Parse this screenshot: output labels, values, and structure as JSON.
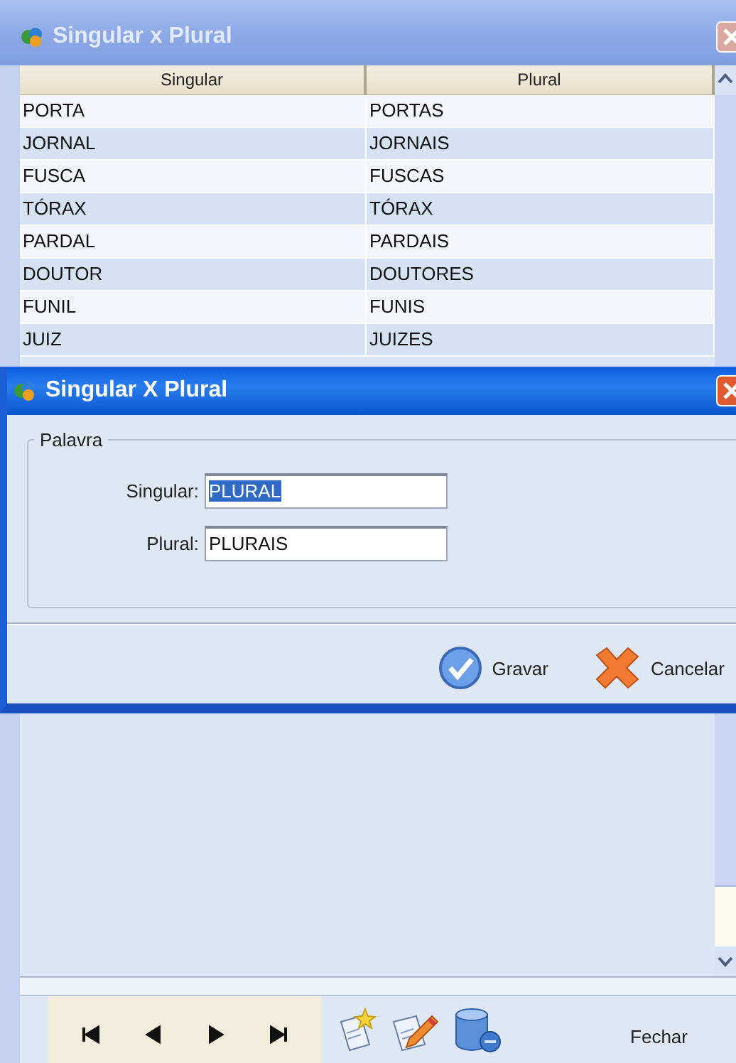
{
  "main_window": {
    "title": "Singular x Plural",
    "active": false
  },
  "table": {
    "columns": [
      "Singular",
      "Plural"
    ],
    "rows": [
      {
        "cells": [
          "PORTA",
          "PORTAS"
        ]
      },
      {
        "cells": [
          "JORNAL",
          "JORNAIS"
        ]
      },
      {
        "cells": [
          "FUSCA",
          "FUSCAS"
        ]
      },
      {
        "cells": [
          "TÓRAX",
          "TÓRAX"
        ]
      },
      {
        "cells": [
          "PARDAL",
          "PARDAIS"
        ]
      },
      {
        "cells": [
          "DOUTOR",
          "DOUTORES"
        ]
      },
      {
        "cells": [
          "FUNIL",
          "FUNIS"
        ]
      },
      {
        "cells": [
          "JUIZ",
          "JUIZES"
        ]
      }
    ]
  },
  "dialog": {
    "title": "Singular X Plural",
    "active": true,
    "group_label": "Palavra",
    "fields": [
      {
        "label": "Singular:",
        "value": "PLURAL",
        "text_selected": true
      },
      {
        "label": "Plural:",
        "value": "PLURAIS",
        "text_selected": false
      }
    ],
    "buttons": [
      {
        "kind": "confirm",
        "label": "Gravar"
      },
      {
        "kind": "cancel",
        "label": "Cancelar"
      }
    ]
  },
  "toolbar": {
    "navigator": [
      {
        "kind": "first"
      },
      {
        "kind": "previous"
      },
      {
        "kind": "next"
      },
      {
        "kind": "last"
      }
    ],
    "actions": [
      {
        "kind": "new"
      },
      {
        "kind": "edit"
      },
      {
        "kind": "delete"
      }
    ],
    "close_label": "Fechar"
  }
}
